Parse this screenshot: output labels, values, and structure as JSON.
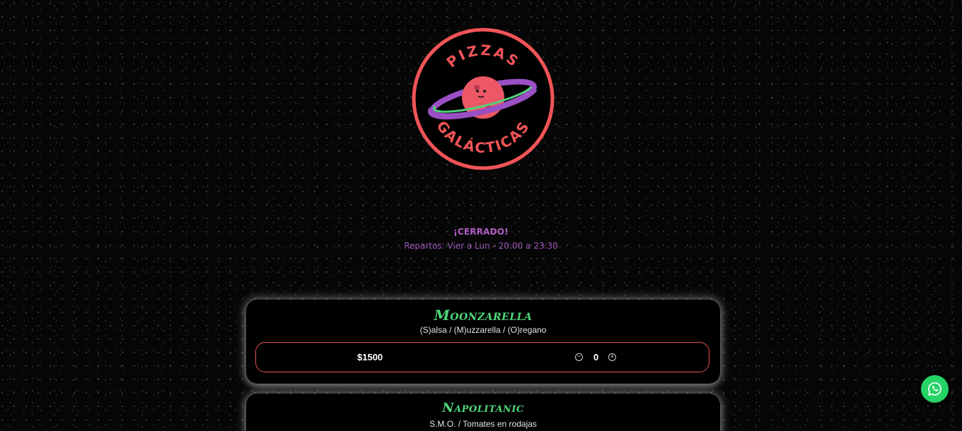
{
  "brand": {
    "logo_top_text": "PIZZAS",
    "logo_bottom_text": "GALÁCTICAS",
    "colors": {
      "ring": "#f25457",
      "planet": "#ec5866",
      "ring_green": "#4fd37d",
      "ring_purple": "#9b4fc4"
    }
  },
  "status": {
    "title": "¡CERRADO!",
    "hours": "Repartos: Vier a Lun - 20:00 a 23:30"
  },
  "products": [
    {
      "name": "Moonzarella",
      "description": "(S)alsa / (M)uzzarella / (O)regano",
      "price": "$1500",
      "quantity": "0",
      "minus_icon": "minus-circle-icon",
      "plus_icon": "plus-circle-icon"
    },
    {
      "name": "Napolitanic",
      "description": "S.M.O. / Tomates en rodajas"
    }
  ],
  "floating": {
    "icon": "whatsapp-icon",
    "color": "#25d366"
  }
}
